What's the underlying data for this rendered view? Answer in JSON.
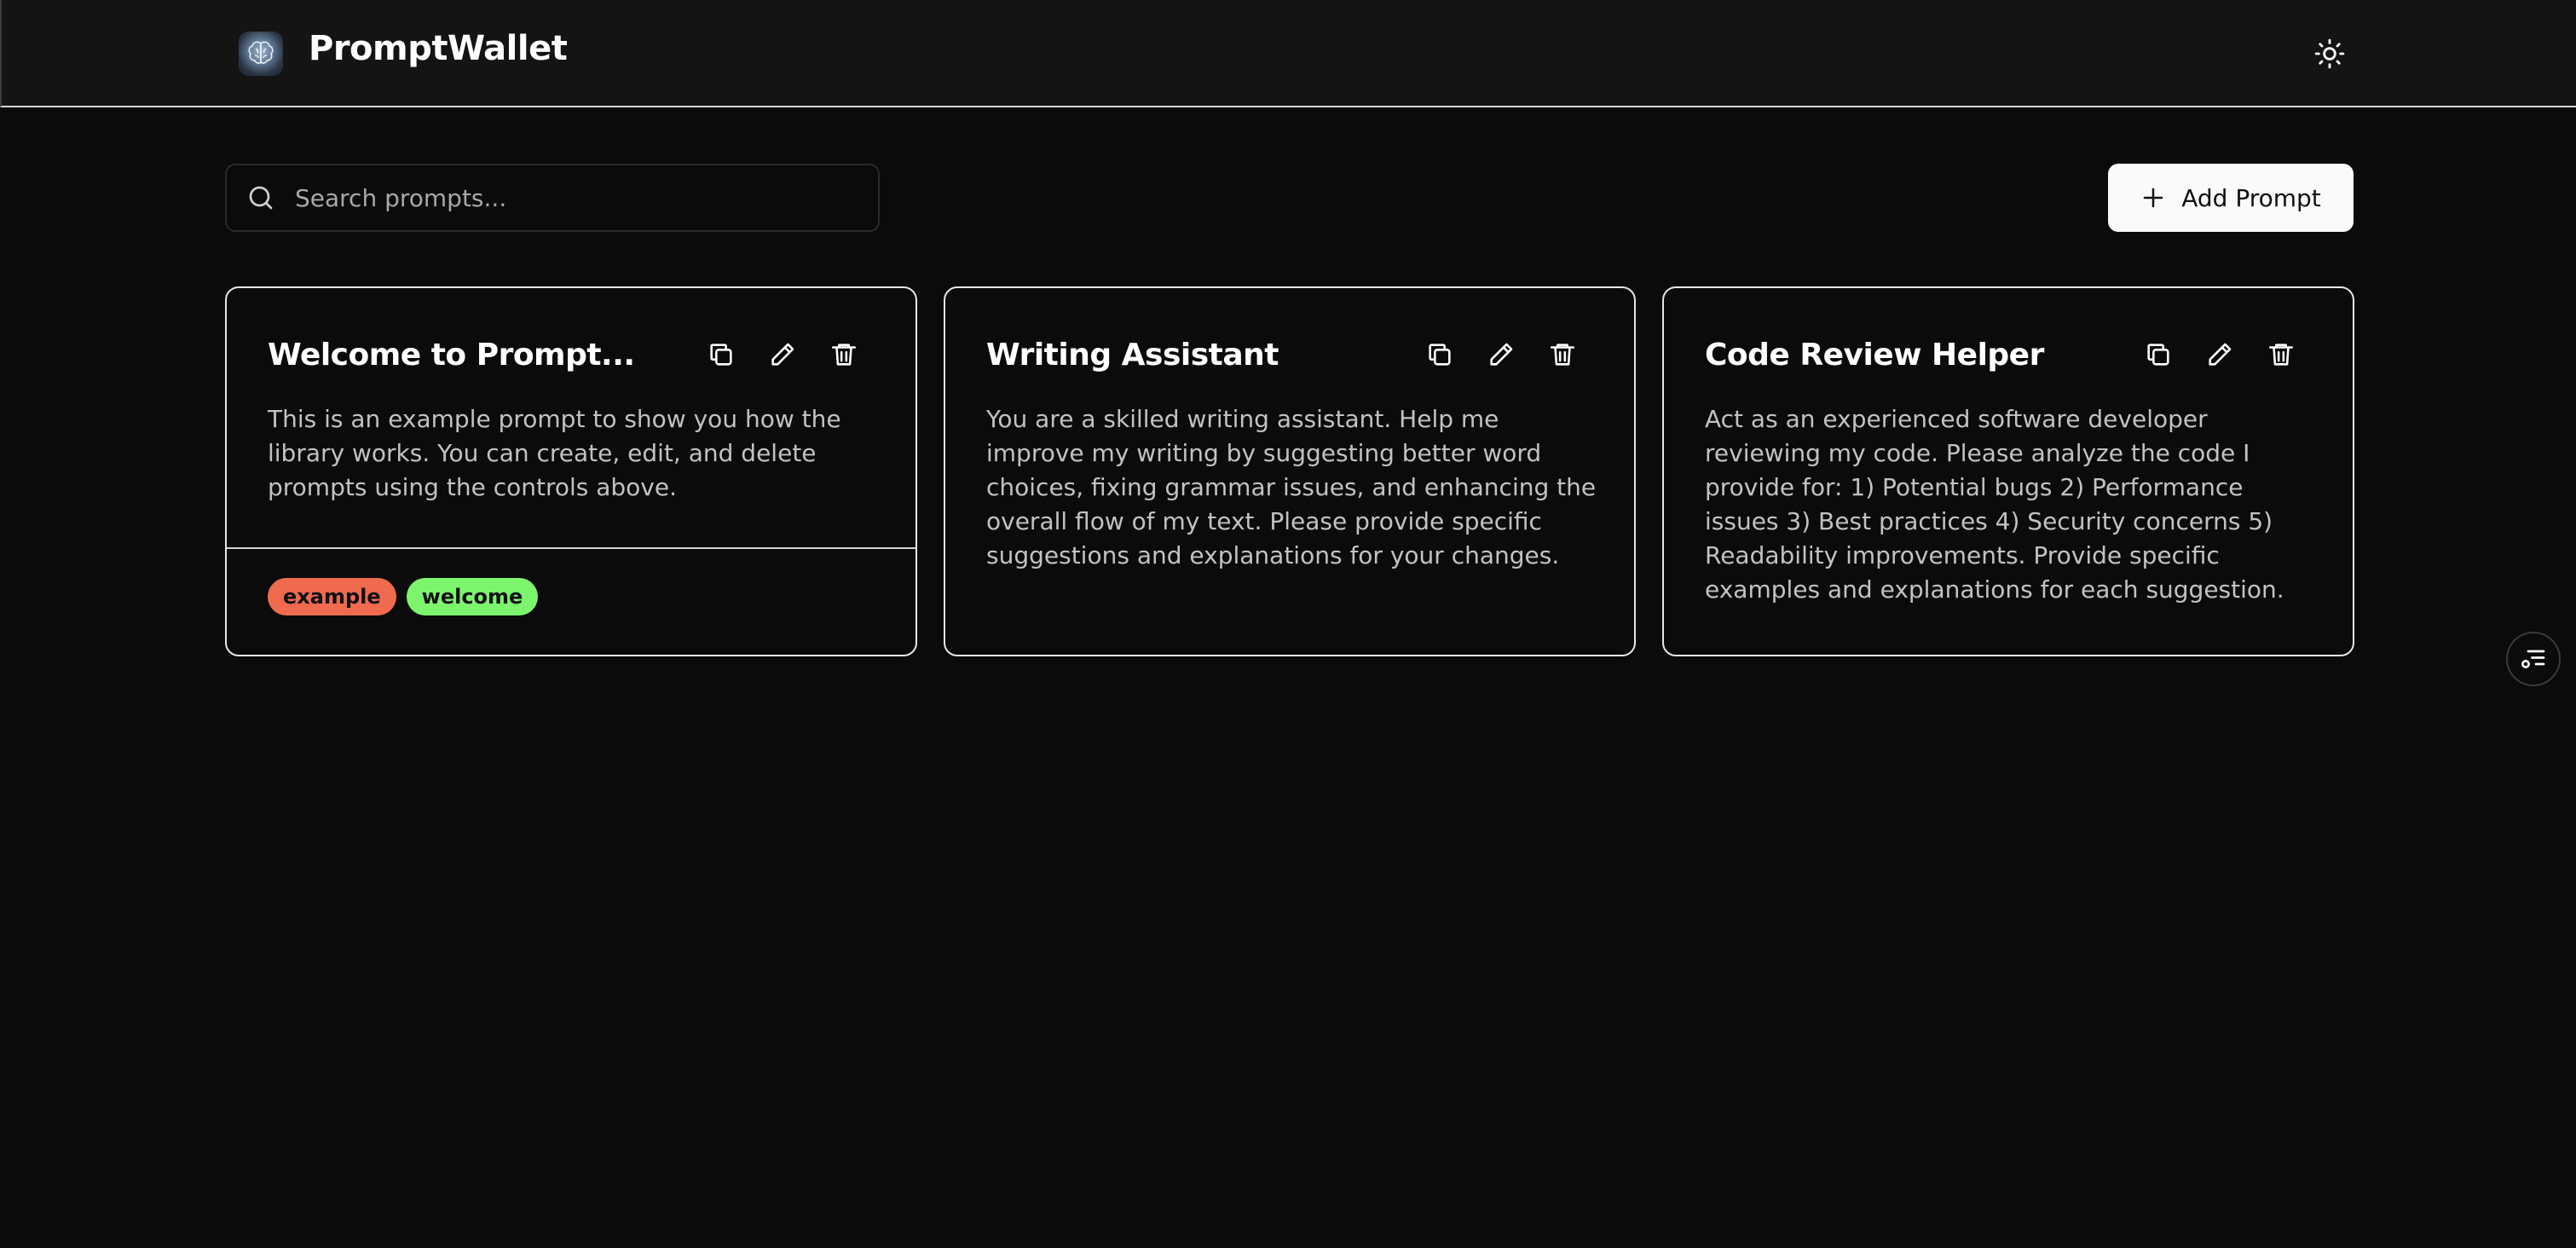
{
  "header": {
    "app_title": "PromptWallet",
    "logo_icon": "brain-logo-icon",
    "theme_icon": "sun-icon"
  },
  "toolbar": {
    "search_placeholder": "Search prompts...",
    "search_value": "",
    "add_label": "Add Prompt"
  },
  "prompts": [
    {
      "title": "Welcome to Prompt...",
      "body": "This is an example prompt to show you how the library works. You can create, edit, and delete prompts using the controls above.",
      "tags": [
        {
          "label": "example",
          "color": "#ef6a4f"
        },
        {
          "label": "welcome",
          "color": "#7cf56d"
        }
      ]
    },
    {
      "title": "Writing Assistant",
      "body": "You are a skilled writing assistant. Help me improve my writing by suggesting better word choices, fixing grammar issues, and enhancing the overall flow of my text. Please provide specific suggestions and explanations for your changes.",
      "tags": []
    },
    {
      "title": "Code Review Helper",
      "body": "Act as an experienced software developer reviewing my code. Please analyze the code I provide for: 1) Potential bugs 2) Performance issues 3) Best practices 4) Security concerns 5) Readability improvements. Provide specific examples and explanations for each suggestion.",
      "tags": []
    }
  ],
  "colors": {
    "background": "#0b0b0b",
    "header_bg": "#141414",
    "card_border": "#e6e6e6",
    "body_text": "#c2c2c2",
    "button_bg": "#fafafa"
  }
}
